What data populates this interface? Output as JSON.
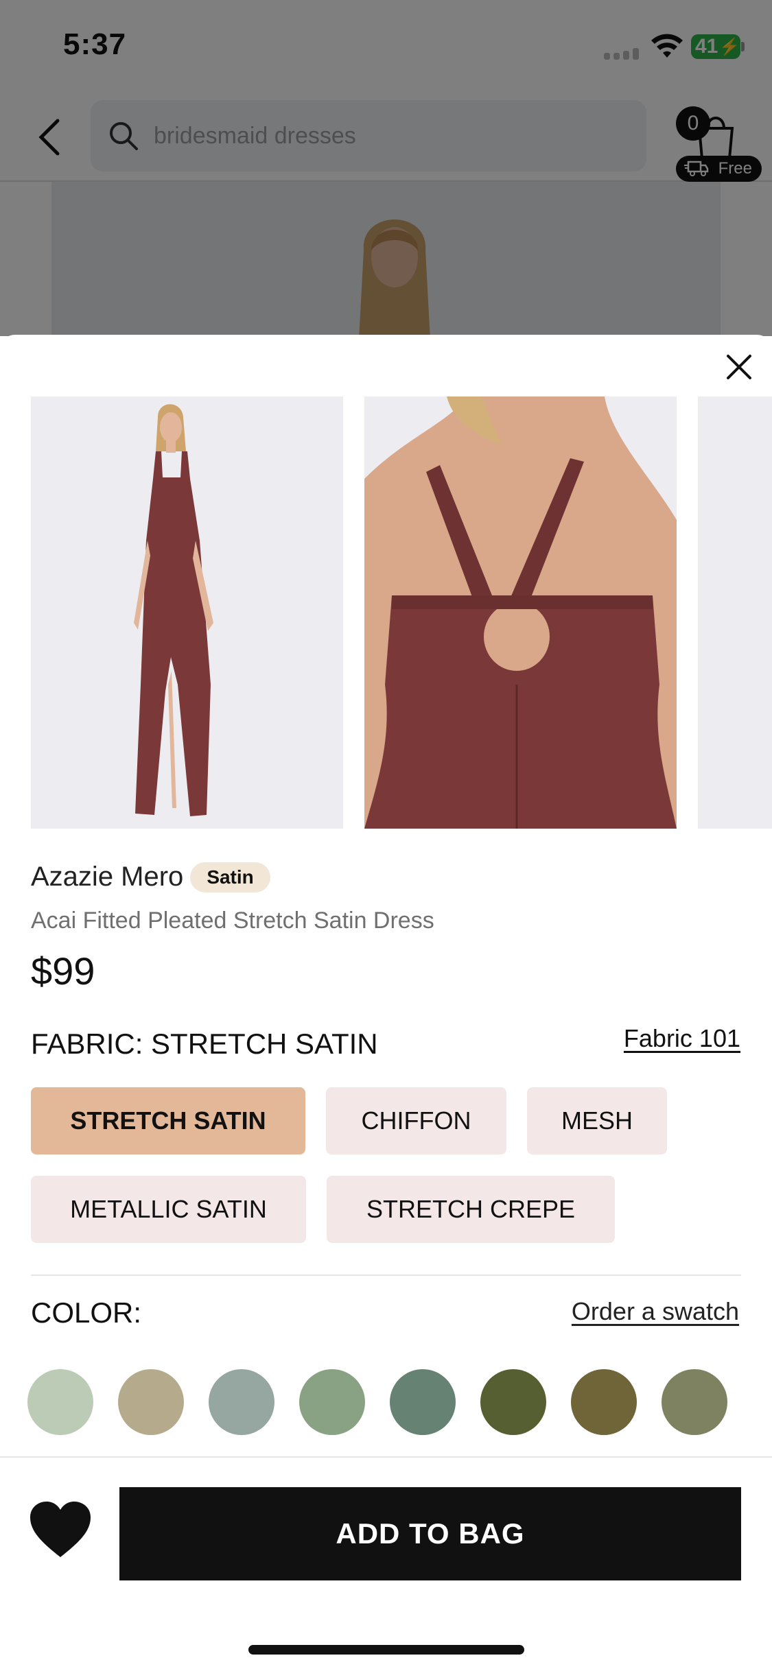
{
  "status_bar": {
    "time": "5:37",
    "battery": "41"
  },
  "nav": {
    "search_placeholder": "bridesmaid dresses",
    "bag_count": "0",
    "bag_free_label": "Free"
  },
  "product": {
    "brand": "Azazie Mero",
    "fabric_badge": "Satin",
    "name": "Acai Fitted Pleated Stretch Satin Dress",
    "price": "$99",
    "dress_color": "#7a3838"
  },
  "fabric": {
    "label": "FABRIC: STRETCH SATIN",
    "link": "Fabric 101",
    "options": [
      "STRETCH SATIN",
      "CHIFFON",
      "MESH",
      "METALLIC SATIN",
      "STRETCH CREPE"
    ],
    "selected": "STRETCH SATIN"
  },
  "color": {
    "label": "COLOR:",
    "link": "Order a swatch",
    "swatches": [
      "#bccbb6",
      "#b5aa8c",
      "#96a6a0",
      "#88a283",
      "#658273",
      "#555f32",
      "#6f6539",
      "#7e8260"
    ]
  },
  "actions": {
    "add_to_bag": "ADD TO BAG",
    "wishlist_icon": "heart-icon"
  }
}
